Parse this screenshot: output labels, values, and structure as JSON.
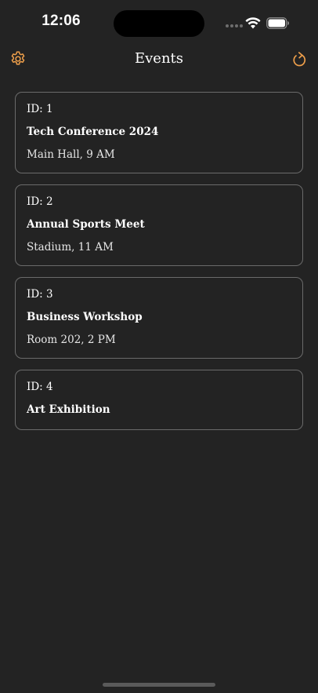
{
  "status_bar": {
    "time": "12:06"
  },
  "nav": {
    "title": "Events",
    "left_icon": "gear-icon",
    "right_icon": "refresh-icon",
    "accent_color": "#f0a04b"
  },
  "events": [
    {
      "id_label": "ID: 1",
      "title": "Tech Conference 2024",
      "detail": "Main Hall, 9 AM"
    },
    {
      "id_label": "ID: 2",
      "title": "Annual Sports Meet",
      "detail": "Stadium, 11 AM"
    },
    {
      "id_label": "ID: 3",
      "title": "Business Workshop",
      "detail": "Room 202, 2 PM"
    },
    {
      "id_label": "ID: 4",
      "title": "Art Exhibition",
      "detail": ""
    }
  ]
}
